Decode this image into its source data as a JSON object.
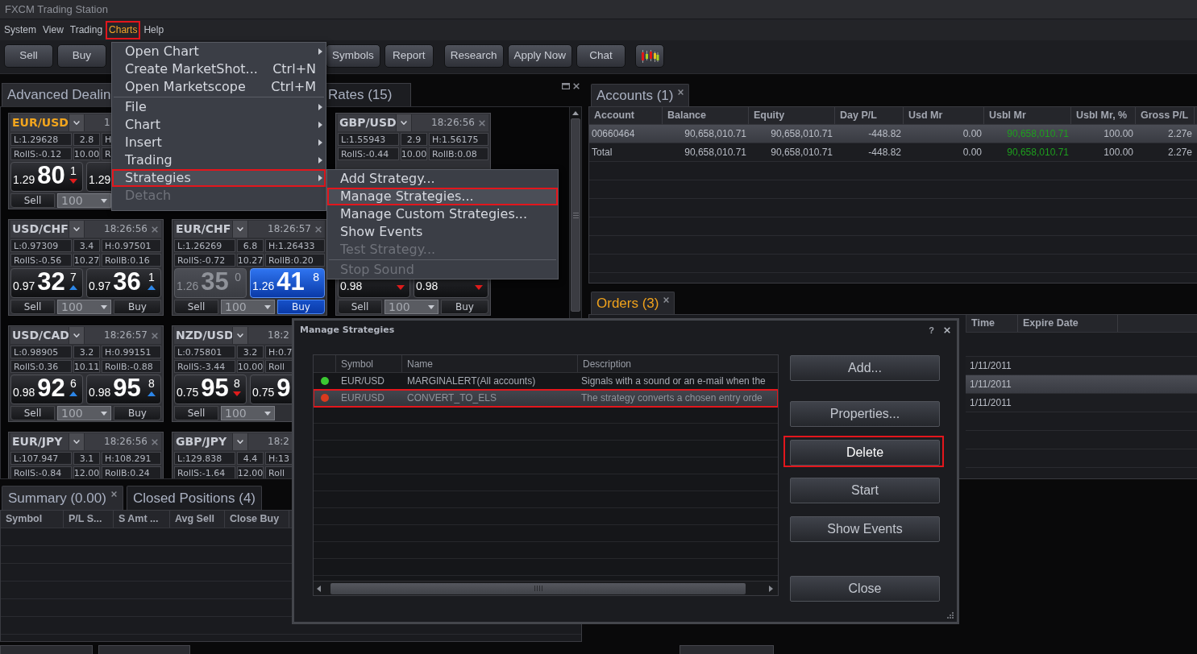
{
  "window": {
    "title": "FXCM Trading Station"
  },
  "menu_bar": [
    {
      "label": "System",
      "selected": false,
      "annotated": false
    },
    {
      "label": "View",
      "selected": false,
      "annotated": false
    },
    {
      "label": "Trading",
      "selected": false,
      "annotated": false
    },
    {
      "label": "Charts",
      "selected": true,
      "annotated": true
    },
    {
      "label": "Help",
      "selected": false,
      "annotated": false
    }
  ],
  "toolbar": {
    "groups": [
      [
        "Sell",
        "Buy"
      ],
      [
        "Symbols",
        "Report"
      ],
      [
        "Research",
        "Apply Now",
        "Chat"
      ]
    ]
  },
  "rates_panel": {
    "tabs": [
      {
        "label": "Advanced Dealin",
        "selected": true
      },
      {
        "label": "Rates (15)",
        "selected": false
      }
    ],
    "tile_rows": [
      [
        {
          "pair": "EUR/USD",
          "selected": true,
          "time": "1",
          "low": "L:1.29628",
          "spread": "2.8",
          "high": "H",
          "roll_sell": "RollS:-0.12",
          "roll_mid": "10.00",
          "roll_buy": "R",
          "sell": {
            "small": "1.29",
            "big": "80",
            "pips": "1",
            "rising": false,
            "highlighted": false,
            "dimmed": false
          },
          "buy": {
            "small": "1.29",
            "highlighted": false,
            "dimmed": false
          },
          "sell_label": "Sell",
          "amount": "100"
        },
        null,
        {
          "pair": "GBP/USD",
          "selected": false,
          "time": "18:26:56",
          "low": "L:1.55943",
          "spread": "2.9",
          "high": "H:1.56175",
          "roll_sell": "RollS:-0.44",
          "roll_mid": "10.00",
          "roll_buy": "RollB:0.08"
        }
      ],
      [
        {
          "pair": "USD/CHF",
          "selected": false,
          "time": "18:26:56",
          "low": "L:0.97309",
          "spread": "3.4",
          "high": "H:0.97501",
          "roll_sell": "RollS:-0.56",
          "roll_mid": "10.27",
          "roll_buy": "RollB:0.16",
          "sell": {
            "small": "0.97",
            "big": "32",
            "pips": "7",
            "rising": true,
            "highlighted": false,
            "dimmed": false
          },
          "buy": {
            "small": "0.97",
            "big": "36",
            "pips": "1",
            "rising": true,
            "highlighted": false,
            "dimmed": false
          },
          "sell_label": "Sell",
          "amount": "100",
          "buy_label": "Buy"
        },
        {
          "pair": "EUR/CHF",
          "selected": false,
          "time": "18:26:57",
          "low": "L:1.26269",
          "spread": "6.8",
          "high": "H:1.26433",
          "roll_sell": "RollS:-0.72",
          "roll_mid": "10.27",
          "roll_buy": "RollB:0.20",
          "sell": {
            "small": "1.26",
            "big": "35",
            "pips": "0",
            "highlighted": false,
            "dimmed": true
          },
          "buy": {
            "small": "1.26",
            "big": "41",
            "pips": "8",
            "highlighted": true,
            "dimmed": false
          },
          "sell_label": "Sell",
          "amount": "100",
          "buy_label": "Buy"
        },
        {
          "sell": {
            "small": "0.98",
            "rising": false,
            "highlighted": false,
            "dimmed": false
          },
          "buy": {
            "small": "0.98",
            "rising": false,
            "highlighted": false,
            "dimmed": false
          },
          "sell_label": "Sell",
          "amount": "100",
          "buy_label": "Buy"
        }
      ],
      [
        {
          "pair": "USD/CAD",
          "selected": false,
          "time": "18:26:57",
          "low": "L:0.98905",
          "spread": "3.2",
          "high": "H:0.99151",
          "roll_sell": "RollS:0.36",
          "roll_mid": "10.11",
          "roll_buy": "RollB:-0.88",
          "sell": {
            "small": "0.98",
            "big": "92",
            "pips": "6",
            "rising": true,
            "highlighted": false,
            "dimmed": false
          },
          "buy": {
            "small": "0.98",
            "big": "95",
            "pips": "8",
            "rising": true,
            "highlighted": false,
            "dimmed": false
          },
          "sell_label": "Sell",
          "amount": "100",
          "buy_label": "Buy"
        },
        {
          "pair": "NZD/USD",
          "selected": false,
          "time": "18:2",
          "low": "L:0.75801",
          "spread": "3.2",
          "high": "H:0.7",
          "roll_sell": "RollS:-3.44",
          "roll_mid": "10.00",
          "roll_buy": "Roll",
          "sell": {
            "small": "0.75",
            "big": "95",
            "pips": "8",
            "rising": false,
            "highlighted": false,
            "dimmed": false
          },
          "buy": {
            "small": "0.75",
            "big": "9",
            "highlighted": false,
            "dimmed": false
          },
          "sell_label": "Sell",
          "amount": "100"
        },
        null
      ],
      [
        {
          "pair": "EUR/JPY",
          "selected": false,
          "time": "18:26:56",
          "low": "L:107.947",
          "spread": "3.1",
          "high": "H:108.291",
          "roll_sell": "RollS:-0.84",
          "roll_mid": "12.00",
          "roll_buy": "RollB:0.24"
        },
        {
          "pair": "GBP/JPY",
          "selected": false,
          "time": "18:2",
          "low": "L:129.838",
          "spread": "4.4",
          "high": "H:13",
          "roll_sell": "RollS:-1.64",
          "roll_mid": "12.00",
          "roll_buy": "Roll"
        },
        null
      ]
    ]
  },
  "accounts_panel": {
    "tab": {
      "label": "Accounts (1)",
      "active": false
    },
    "columns": [
      "Account",
      "Balance",
      "Equity",
      "Day P/L",
      "Usd Mr",
      "Usbl Mr",
      "Usbl Mr, %",
      "Gross P/L"
    ],
    "rows": [
      {
        "cells": [
          "00660464",
          "90,658,010.71",
          "90,658,010.71",
          "-448.82",
          "0.00",
          "90,658,010.71",
          "100.00",
          "2.27e"
        ],
        "selected": true
      },
      {
        "cells": [
          "Total",
          "90,658,010.71",
          "90,658,010.71",
          "-448.82",
          "0.00",
          "90,658,010.71",
          "100.00",
          "2.27e"
        ],
        "selected": false
      }
    ]
  },
  "orders_panel": {
    "tab": {
      "label": "Orders (3)",
      "active": true
    },
    "columns": [
      "Time",
      "Expire Date"
    ],
    "rows": [
      {
        "cells": [
          "1/11/2011"
        ],
        "selected": false
      },
      {
        "cells": [
          "1/11/2011"
        ],
        "selected": true
      },
      {
        "cells": [
          "1/11/2011"
        ],
        "selected": false
      }
    ]
  },
  "summary_panel": {
    "tabs": [
      {
        "label": "Summary (0.00)",
        "selected": true
      },
      {
        "label": "Closed Positions (4)",
        "selected": false
      }
    ],
    "columns": [
      "Symbol",
      "P/L S...",
      "S Amt ...",
      "Avg Sell",
      "Close Buy"
    ]
  },
  "charts_menu": {
    "items": [
      {
        "label": "Open Chart",
        "kind": "submenu",
        "disabled": false,
        "highlighted": false,
        "annotated": false
      },
      {
        "label": "Create MarketShot...",
        "shortcut": "Ctrl+N",
        "kind": "command",
        "disabled": false,
        "highlighted": false,
        "annotated": false
      },
      {
        "label": "Open Marketscope",
        "shortcut": "Ctrl+M",
        "kind": "command",
        "disabled": false,
        "highlighted": false,
        "annotated": false
      },
      {
        "kind": "separator"
      },
      {
        "label": "File",
        "kind": "submenu",
        "disabled": false,
        "highlighted": false,
        "annotated": false
      },
      {
        "label": "Chart",
        "kind": "submenu",
        "disabled": false,
        "highlighted": false,
        "annotated": false
      },
      {
        "label": "Insert",
        "kind": "submenu",
        "disabled": false,
        "highlighted": false,
        "annotated": false
      },
      {
        "label": "Trading",
        "kind": "submenu",
        "disabled": false,
        "highlighted": false,
        "annotated": false
      },
      {
        "label": "Strategies",
        "kind": "submenu",
        "disabled": false,
        "highlighted": true,
        "annotated": true
      },
      {
        "label": "Detach",
        "kind": "command",
        "disabled": true,
        "highlighted": false,
        "annotated": false
      }
    ]
  },
  "strategies_submenu": {
    "items": [
      {
        "label": "Add Strategy...",
        "kind": "command",
        "disabled": false,
        "highlighted": false,
        "annotated": false
      },
      {
        "label": "Manage Strategies...",
        "kind": "command",
        "disabled": false,
        "highlighted": true,
        "annotated": true
      },
      {
        "label": "Manage Custom Strategies...",
        "kind": "command",
        "disabled": false,
        "highlighted": false,
        "annotated": false
      },
      {
        "label": "Show Events",
        "kind": "command",
        "disabled": false,
        "highlighted": false,
        "annotated": false
      },
      {
        "label": "Test Strategy...",
        "kind": "command",
        "disabled": true,
        "highlighted": false,
        "annotated": false
      },
      {
        "kind": "separator"
      },
      {
        "label": "Stop Sound",
        "kind": "command",
        "disabled": true,
        "highlighted": false,
        "annotated": false
      }
    ]
  },
  "dialog": {
    "title": "Manage Strategies",
    "help_label": "?",
    "columns": [
      "Symbol",
      "Name",
      "Description"
    ],
    "rows": [
      {
        "color": "#3cc832",
        "symbol": "EUR/USD",
        "name": "MARGINALERT(All accounts)",
        "description": "Signals with a sound or an e-mail when the",
        "selected": false,
        "annotated": false
      },
      {
        "color": "#d83a1e",
        "symbol": "EUR/USD",
        "name": "CONVERT_TO_ELS",
        "description": "The strategy converts a chosen entry orde",
        "selected": true,
        "annotated": true
      }
    ],
    "buttons": [
      {
        "label": "Add...",
        "focused": false,
        "annotated": false
      },
      {
        "label": "Properties...",
        "focused": false,
        "annotated": false
      },
      {
        "label": "Delete",
        "focused": true,
        "annotated": true
      },
      {
        "label": "Start",
        "focused": false,
        "annotated": false
      },
      {
        "label": "Show Events",
        "focused": false,
        "annotated": false
      },
      {
        "label": "Close",
        "focused": false,
        "annotated": false
      }
    ]
  }
}
